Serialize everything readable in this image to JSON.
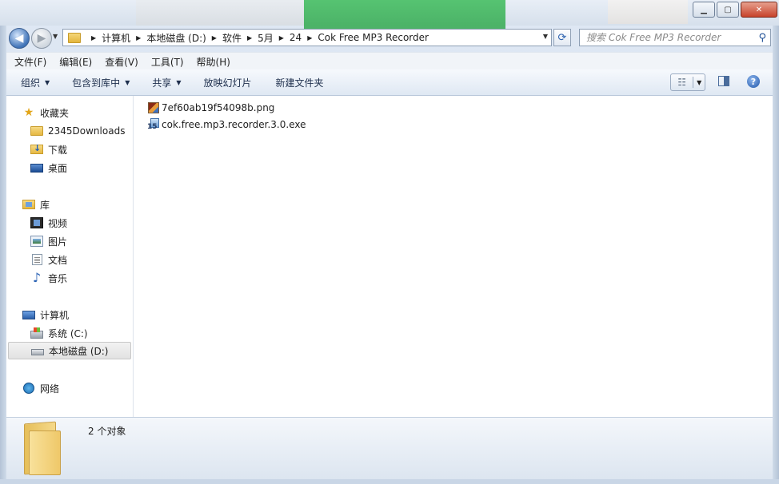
{
  "window": {
    "minimize_label": "▁",
    "maximize_label": "▢",
    "close_label": "✕"
  },
  "nav": {
    "back_label": "◀",
    "forward_label": "▶",
    "recent_label": "▼",
    "refresh_label": "⟳",
    "address_dropdown_label": "▼",
    "breadcrumb": [
      "计算机",
      "本地磁盘 (D:)",
      "软件",
      "5月",
      "24",
      "Cok Free MP3 Recorder"
    ],
    "crumb_separator": "▶",
    "search_placeholder": "搜索 Cok Free MP3 Recorder",
    "search_icon": "magnifier-icon"
  },
  "menu": {
    "items": [
      "文件(F)",
      "编辑(E)",
      "查看(V)",
      "工具(T)",
      "帮助(H)"
    ]
  },
  "commands": {
    "organize": "组织",
    "include_library": "包含到库中",
    "share": "共享",
    "slideshow": "放映幻灯片",
    "new_folder": "新建文件夹",
    "dropdown_arrow": "▼",
    "views_icon_glyph": "☷",
    "help_label": "?"
  },
  "navpane": {
    "favorites": {
      "label": "收藏夹",
      "items": [
        "2345Downloads",
        "下载",
        "桌面"
      ]
    },
    "libraries": {
      "label": "库",
      "items": [
        "视频",
        "图片",
        "文档",
        "音乐"
      ]
    },
    "computer": {
      "label": "计算机",
      "items": [
        "系统 (C:)",
        "本地磁盘 (D:)"
      ],
      "selected": "本地磁盘 (D:)"
    },
    "network": {
      "label": "网络"
    }
  },
  "files": [
    {
      "name": "7ef60ab19f54098b.png",
      "icon": "png-image-icon"
    },
    {
      "name": "cok.free.mp3.recorder.3.0.exe",
      "icon": "exe-installer-icon"
    }
  ],
  "details": {
    "count_text": "2 个对象"
  },
  "colors": {
    "frame": "#cfdbe9",
    "close_button": "#c7432b",
    "selection": "#e2e2e2",
    "link_blue": "#1f4f95"
  }
}
